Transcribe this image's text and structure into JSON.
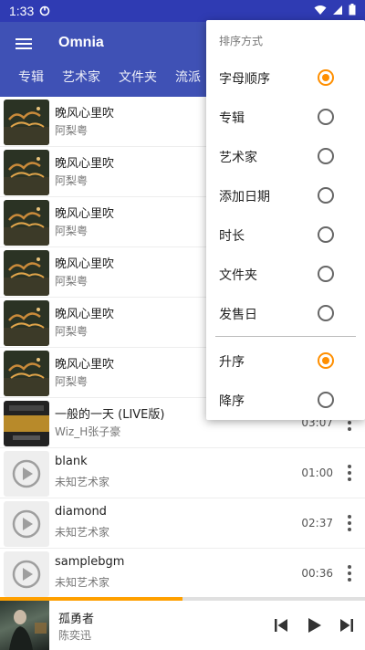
{
  "status_bar": {
    "time": "1:33"
  },
  "app": {
    "title": "Omnia"
  },
  "tabs": [
    "专辑",
    "艺术家",
    "文件夹",
    "流派"
  ],
  "songs": [
    {
      "title": "晚风心里吹",
      "artist": "阿梨粤",
      "duration": "",
      "art": "album"
    },
    {
      "title": "晚风心里吹",
      "artist": "阿梨粤",
      "duration": "",
      "art": "album"
    },
    {
      "title": "晚风心里吹",
      "artist": "阿梨粤",
      "duration": "",
      "art": "album"
    },
    {
      "title": "晚风心里吹",
      "artist": "阿梨粤",
      "duration": "",
      "art": "album"
    },
    {
      "title": "晚风心里吹",
      "artist": "阿梨粤",
      "duration": "",
      "art": "album"
    },
    {
      "title": "晚风心里吹",
      "artist": "阿梨粤",
      "duration": "",
      "art": "album"
    },
    {
      "title": "一般的一天 (LIVE版)",
      "artist": "Wiz_H张子豪",
      "duration": "03:07",
      "art": "rapchina"
    },
    {
      "title": "blank",
      "artist": "未知艺术家",
      "duration": "01:00",
      "art": "placeholder"
    },
    {
      "title": "diamond",
      "artist": "未知艺术家",
      "duration": "02:37",
      "art": "placeholder"
    },
    {
      "title": "samplebgm",
      "artist": "未知艺术家",
      "duration": "00:36",
      "art": "placeholder"
    }
  ],
  "now_playing": {
    "title": "孤勇者",
    "artist": "陈奕迅",
    "progress": 0.5
  },
  "sort_menu": {
    "header": "排序方式",
    "options": [
      {
        "label": "字母顺序",
        "selected": true
      },
      {
        "label": "专辑",
        "selected": false
      },
      {
        "label": "艺术家",
        "selected": false
      },
      {
        "label": "添加日期",
        "selected": false
      },
      {
        "label": "时长",
        "selected": false
      },
      {
        "label": "文件夹",
        "selected": false
      },
      {
        "label": "发售日",
        "selected": false
      }
    ],
    "order": [
      {
        "label": "升序",
        "selected": true
      },
      {
        "label": "降序",
        "selected": false
      }
    ]
  },
  "colors": {
    "primary": "#3f51b5",
    "status_bar": "#2f3bb3",
    "accent": "#ff8f00"
  }
}
